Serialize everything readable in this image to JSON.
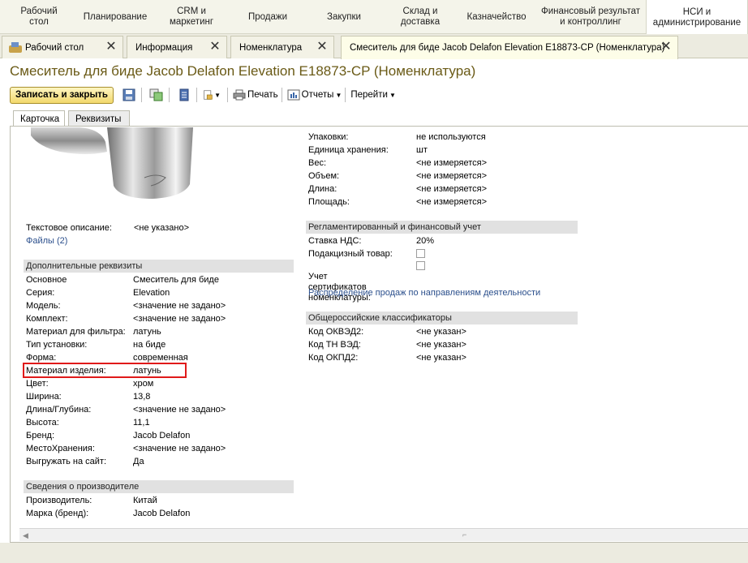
{
  "sections": [
    {
      "label": "Рабочий\nстол"
    },
    {
      "label": "Планирование"
    },
    {
      "label": "CRM и\nмаркетинг"
    },
    {
      "label": "Продажи"
    },
    {
      "label": "Закупки"
    },
    {
      "label": "Склад и\nдоставка"
    },
    {
      "label": "Казначейство"
    },
    {
      "label": "Финансовый результат\nи контроллинг"
    },
    {
      "label": "НСИ и\nадминистрирование"
    }
  ],
  "window_tabs": [
    {
      "label": "Рабочий стол"
    },
    {
      "label": "Информация"
    },
    {
      "label": "Номенклатура"
    },
    {
      "label": "Смеситель для биде Jacob Delafon Elevation E18873-CP (Номенклатура)"
    }
  ],
  "title": "Смеситель для биде Jacob Delafon Elevation E18873-CP (Номенклатура)",
  "toolbar": {
    "save_close": "Записать и закрыть",
    "print": "Печать",
    "reports": "Отчеты",
    "goto": "Перейти"
  },
  "form_tabs": [
    {
      "label": "Карточка"
    },
    {
      "label": "Реквизиты"
    }
  ],
  "left": {
    "text_desc": {
      "label": "Текстовое описание:",
      "value": "<не указано>"
    },
    "files_link": "Файлы (2)",
    "extra_header": "Дополнительные реквизиты",
    "extra": [
      {
        "label": "Основное",
        "value": "Смеситель для биде"
      },
      {
        "label": "Серия:",
        "value": "Elevation"
      },
      {
        "label": "Модель:",
        "value": "<значение не задано>"
      },
      {
        "label": "Комплект:",
        "value": "<значение не задано>"
      },
      {
        "label": "Материал для фильтра:",
        "value": "латунь"
      },
      {
        "label": "Тип установки:",
        "value": "на биде"
      },
      {
        "label": "Форма:",
        "value": "современная"
      },
      {
        "label": "Материал изделия:",
        "value": "латунь"
      },
      {
        "label": "Цвет:",
        "value": "хром"
      },
      {
        "label": "Ширина:",
        "value": "13,8"
      },
      {
        "label": "Длина/Глубина:",
        "value": "<значение не задано>"
      },
      {
        "label": "Высота:",
        "value": "11,1"
      },
      {
        "label": "Бренд:",
        "value": "Jacob Delafon"
      },
      {
        "label": "МестоХранения:",
        "value": "<значение не задано>"
      },
      {
        "label": "Выгружать на сайт:",
        "value": "Да"
      }
    ],
    "maker_header": "Сведения о производителе",
    "maker": [
      {
        "label": "Производитель:",
        "value": "Китай"
      },
      {
        "label": "Марка (бренд):",
        "value": "Jacob Delafon"
      }
    ]
  },
  "right": {
    "units": [
      {
        "label": "Упаковки:",
        "value": "не используются"
      },
      {
        "label": "Единица хранения:",
        "value": "шт"
      },
      {
        "label": "Вес:",
        "value": "<не измеряется>"
      },
      {
        "label": "Объем:",
        "value": "<не измеряется>"
      },
      {
        "label": "Длина:",
        "value": "<не измеряется>"
      },
      {
        "label": "Площадь:",
        "value": "<не измеряется>"
      }
    ],
    "reg_header": "Регламентированный и финансовый учет",
    "vat": {
      "label": "Ставка НДС:",
      "value": "20%"
    },
    "excise_label": "Подакцизный товар:",
    "cert_label": "Учет сертификатов\nноменклатуры:",
    "sales_link": "Распределение продаж по направлениям деятельности",
    "class_header": "Общероссийские классификаторы",
    "classifiers": [
      {
        "label": "Код ОКВЭД2:",
        "value": "<не указан>"
      },
      {
        "label": "Код ТН ВЭД:",
        "value": "<не указан>"
      },
      {
        "label": "Код ОКПД2:",
        "value": "<не указан>"
      }
    ]
  },
  "icons": [
    "desktop-icon",
    "close-icon",
    "save-icon",
    "save-copy-icon",
    "list-icon",
    "document-icon",
    "print-icon",
    "reports-icon"
  ],
  "colors": {
    "accent": "#f2d86c",
    "title": "#6a5a16",
    "link": "#2b4f8c",
    "highlight": "#e01a1a"
  }
}
